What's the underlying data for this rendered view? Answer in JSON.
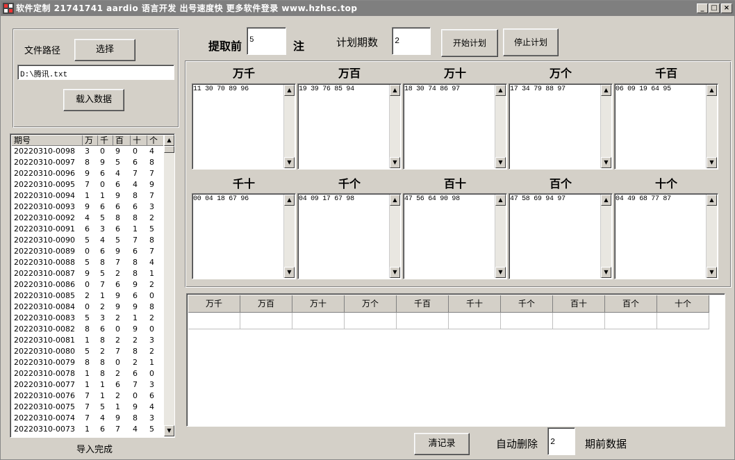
{
  "titlebar": {
    "title": "软件定制 21741741 aardio 语言开发 出号速度快 更多软件登录 www.hzhsc.top",
    "minimize": "_",
    "maximize": "□",
    "close": "×"
  },
  "file_panel": {
    "path_label": "文件路径",
    "select_button": "选择",
    "path_value": "D:\\腾讯.txt",
    "load_button": "载入数据",
    "import_status": "导入完成"
  },
  "history": {
    "headers": [
      "期号",
      "万",
      "千",
      "百",
      "十",
      "个"
    ],
    "rows": [
      [
        "20220310-0098",
        "3",
        "0",
        "9",
        "0",
        "4"
      ],
      [
        "20220310-0097",
        "8",
        "9",
        "5",
        "6",
        "8"
      ],
      [
        "20220310-0096",
        "9",
        "6",
        "4",
        "7",
        "7"
      ],
      [
        "20220310-0095",
        "7",
        "0",
        "6",
        "4",
        "9"
      ],
      [
        "20220310-0094",
        "1",
        "1",
        "9",
        "8",
        "7"
      ],
      [
        "20220310-0093",
        "9",
        "6",
        "6",
        "6",
        "3"
      ],
      [
        "20220310-0092",
        "4",
        "5",
        "8",
        "8",
        "2"
      ],
      [
        "20220310-0091",
        "6",
        "3",
        "6",
        "1",
        "5"
      ],
      [
        "20220310-0090",
        "5",
        "4",
        "5",
        "7",
        "8"
      ],
      [
        "20220310-0089",
        "0",
        "6",
        "9",
        "6",
        "7"
      ],
      [
        "20220310-0088",
        "5",
        "8",
        "7",
        "8",
        "4"
      ],
      [
        "20220310-0087",
        "9",
        "5",
        "2",
        "8",
        "1"
      ],
      [
        "20220310-0086",
        "0",
        "7",
        "6",
        "9",
        "2"
      ],
      [
        "20220310-0085",
        "2",
        "1",
        "9",
        "6",
        "0"
      ],
      [
        "20220310-0084",
        "0",
        "2",
        "9",
        "9",
        "8"
      ],
      [
        "20220310-0083",
        "5",
        "3",
        "2",
        "1",
        "2"
      ],
      [
        "20220310-0082",
        "8",
        "6",
        "0",
        "9",
        "0"
      ],
      [
        "20220310-0081",
        "1",
        "8",
        "2",
        "2",
        "3"
      ],
      [
        "20220310-0080",
        "5",
        "2",
        "7",
        "8",
        "2"
      ],
      [
        "20220310-0079",
        "8",
        "8",
        "0",
        "2",
        "1"
      ],
      [
        "20220310-0078",
        "1",
        "8",
        "2",
        "6",
        "0"
      ],
      [
        "20220310-0077",
        "1",
        "1",
        "6",
        "7",
        "3"
      ],
      [
        "20220310-0076",
        "7",
        "1",
        "2",
        "0",
        "6"
      ],
      [
        "20220310-0075",
        "7",
        "5",
        "1",
        "9",
        "4"
      ],
      [
        "20220310-0074",
        "7",
        "4",
        "9",
        "8",
        "3"
      ],
      [
        "20220310-0073",
        "1",
        "6",
        "7",
        "4",
        "5"
      ]
    ]
  },
  "controls": {
    "take_front_label": "提取前",
    "take_front_value": "5",
    "unit_label": "注",
    "plan_periods_label": "计划期数",
    "plan_periods_value": "2",
    "start_button": "开始计划",
    "stop_button": "停止计划"
  },
  "positions": [
    {
      "title": "万千",
      "numbers": "11 30 70 89 96"
    },
    {
      "title": "万百",
      "numbers": "19 39 76 85 94"
    },
    {
      "title": "万十",
      "numbers": "18 30 74 86 97"
    },
    {
      "title": "万个",
      "numbers": "17 34 79 88 97"
    },
    {
      "title": "千百",
      "numbers": "06 09 19 64 95"
    },
    {
      "title": "千十",
      "numbers": "00 04 18 67 96"
    },
    {
      "title": "千个",
      "numbers": "04 09 17 67 98"
    },
    {
      "title": "百十",
      "numbers": "47 56 64 90 98"
    },
    {
      "title": "百个",
      "numbers": "47 58 69 94 97"
    },
    {
      "title": "十个",
      "numbers": "04 49 68 77 87"
    }
  ],
  "results": {
    "headers": [
      "万千",
      "万百",
      "万十",
      "万个",
      "千百",
      "千十",
      "千个",
      "百十",
      "百个",
      "十个"
    ]
  },
  "bottom": {
    "clear_button": "清记录",
    "auto_delete_label": "自动删除",
    "auto_delete_value": "2",
    "period_data_label": "期前数据"
  }
}
